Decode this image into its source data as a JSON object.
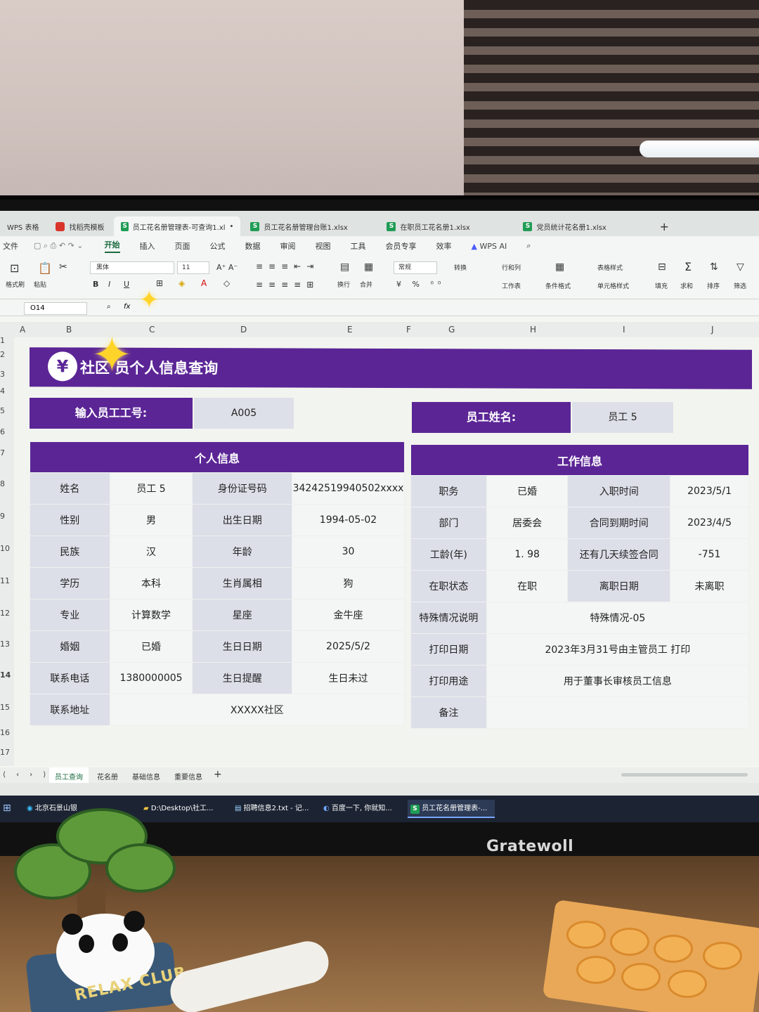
{
  "window_tabs": [
    {
      "label": "WPS 表格",
      "icon": "wps-icon"
    },
    {
      "label": "找稻壳模板",
      "icon": "docer-icon"
    },
    {
      "label": "员工花名册管理表-可查询1.xl",
      "icon": "sheet-icon",
      "active": true
    },
    {
      "label": "员工花名册管理台账1.xlsx",
      "icon": "sheet-icon"
    },
    {
      "label": "在职员工花名册1.xlsx",
      "icon": "sheet-icon"
    },
    {
      "label": "党员统计花名册1.xlsx",
      "icon": "sheet-icon"
    }
  ],
  "menu": {
    "file": "文件",
    "items": [
      "开始",
      "插入",
      "页面",
      "公式",
      "数据",
      "审阅",
      "视图",
      "工具",
      "会员专享",
      "效率"
    ],
    "selected": "开始",
    "ai": "WPS AI"
  },
  "ribbon": {
    "format_painter": "格式刷",
    "paste": "粘贴",
    "font_name": "黑体",
    "font_size": "11",
    "wrap": "换行",
    "merge": "合并",
    "number_format": "常规",
    "convert": "转换",
    "row_col": "行和列",
    "worksheet": "工作表",
    "cond_format": "条件格式",
    "table_style": "表格样式",
    "cell_style": "单元格样式",
    "fill": "填充",
    "sum": "求和",
    "sort": "排序",
    "filter": "筛选"
  },
  "formula_bar": {
    "cell_ref": "O14",
    "fx": "fx"
  },
  "columns": [
    "A",
    "B",
    "C",
    "D",
    "E",
    "F",
    "G",
    "H",
    "I",
    "J"
  ],
  "rows": [
    "1",
    "2",
    "3",
    "4",
    "5",
    "6",
    "7",
    "8",
    "9",
    "10",
    "11",
    "12",
    "13",
    "14",
    "15",
    "16",
    "17"
  ],
  "sheet": {
    "title": "社区 员个人信息查询",
    "title_icon": "yen-search-icon",
    "input_label": "输入员工工号:",
    "input_value": "A005",
    "name_label": "员工姓名:",
    "name_value": "员工 5",
    "personal_header": "个人信息",
    "work_header": "工作信息",
    "personal_rows": [
      [
        "姓名",
        "员工 5",
        "身份证号码",
        "34242519940502xxxx"
      ],
      [
        "性别",
        "男",
        "出生日期",
        "1994-05-02"
      ],
      [
        "民族",
        "汉",
        "年龄",
        "30"
      ],
      [
        "学历",
        "本科",
        "生肖属相",
        "狗"
      ],
      [
        "专业",
        "计算数学",
        "星座",
        "金牛座"
      ],
      [
        "婚姻",
        "已婚",
        "生日日期",
        "2025/5/2"
      ],
      [
        "联系电话",
        "1380000005",
        "生日提醒",
        "生日未过"
      ]
    ],
    "address_label": "联系地址",
    "address_value": "XXXXX社区",
    "work_rows": [
      [
        "职务",
        "已婚",
        "入职时间",
        "2023/5/1"
      ],
      [
        "部门",
        "居委会",
        "合同到期时间",
        "2023/4/5"
      ],
      [
        "工龄(年)",
        "1. 98",
        "还有几天续签合同",
        "-751"
      ],
      [
        "在职状态",
        "在职",
        "离职日期",
        "未离职"
      ]
    ],
    "work_wide_rows": [
      [
        "特殊情况说明",
        "特殊情况-05"
      ],
      [
        "打印日期",
        "2023年3月31号由主管员工 打印"
      ],
      [
        "打印用途",
        "用于董事长审核员工信息"
      ],
      [
        "备注",
        ""
      ]
    ]
  },
  "sheet_tabs": [
    "员工查询",
    "花名册",
    "基础信息",
    "重要信息"
  ],
  "active_sheet_tab": "员工查询",
  "taskbar": [
    {
      "label": "北京石景山银",
      "icon": "edge-icon"
    },
    {
      "label": "D:\\Desktop\\社工...",
      "icon": "folder-icon"
    },
    {
      "label": "招聘信息2.txt - 记...",
      "icon": "notepad-icon"
    },
    {
      "label": "百度一下, 你就知...",
      "icon": "browser-icon"
    },
    {
      "label": "员工花名册管理表-...",
      "icon": "sheet-icon",
      "active": true
    }
  ],
  "monitor_brand": "Gratewoll",
  "figurine_text": "RELAX CLUB",
  "colors": {
    "purple": "#5b2596",
    "label_grey": "#dcdfe8",
    "sheet_bg": "#f2f5ef",
    "accent_green": "#1a6a3e"
  }
}
